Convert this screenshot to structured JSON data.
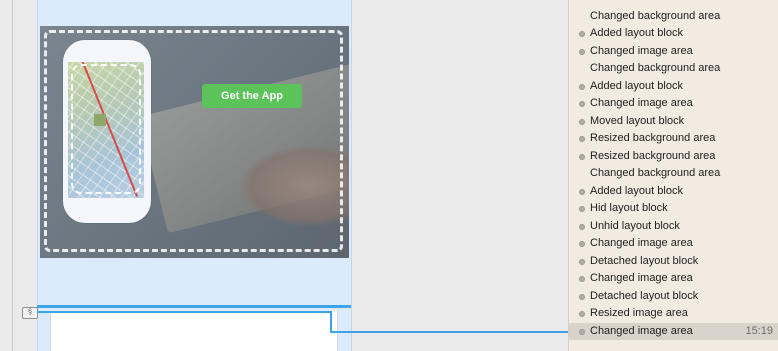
{
  "canvas": {
    "cta_label": "Get the App"
  },
  "history": {
    "items": [
      {
        "label": "Changed background area",
        "dot": false
      },
      {
        "label": "Added layout block",
        "dot": true
      },
      {
        "label": "Changed image area",
        "dot": true
      },
      {
        "label": "Changed background area",
        "dot": false
      },
      {
        "label": "Added layout block",
        "dot": true
      },
      {
        "label": "Changed image area",
        "dot": true
      },
      {
        "label": "Moved layout block",
        "dot": true
      },
      {
        "label": "Resized background area",
        "dot": true
      },
      {
        "label": "Resized background area",
        "dot": true
      },
      {
        "label": "Changed background area",
        "dot": false
      },
      {
        "label": "Added layout block",
        "dot": true
      },
      {
        "label": "Hid layout block",
        "dot": true
      },
      {
        "label": "Unhid layout block",
        "dot": true
      },
      {
        "label": "Changed image area",
        "dot": true
      },
      {
        "label": "Detached layout block",
        "dot": true
      },
      {
        "label": "Changed image area",
        "dot": true
      },
      {
        "label": "Detached layout block",
        "dot": true
      },
      {
        "label": "Resized image area",
        "dot": true
      },
      {
        "label": "Changed image area",
        "dot": true,
        "selected": true,
        "time": "15:19"
      }
    ]
  }
}
